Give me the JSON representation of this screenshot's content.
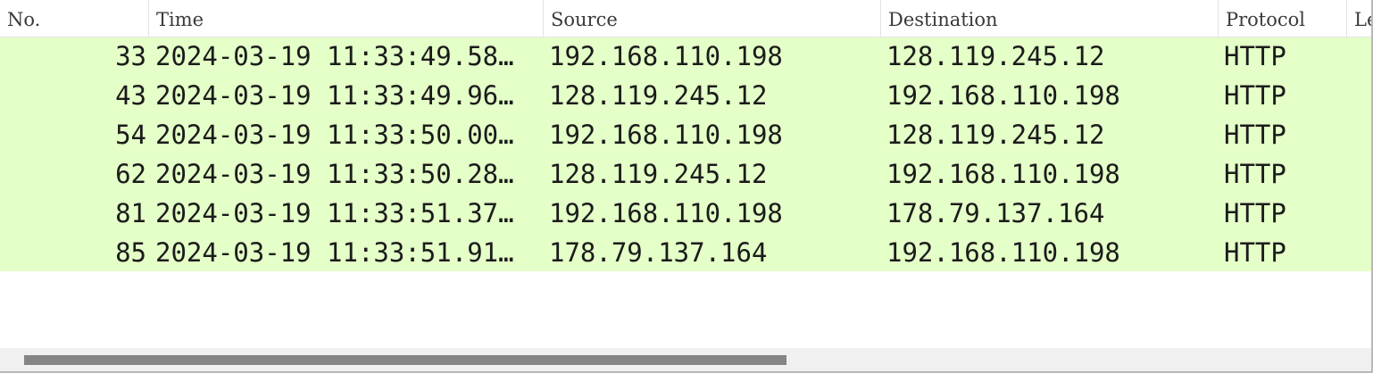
{
  "columns": {
    "no": "No.",
    "time": "Time",
    "source": "Source",
    "destination": "Destination",
    "protocol": "Protocol",
    "length": "Le"
  },
  "packets": [
    {
      "no": "33",
      "time": "2024-03-19 11:33:49.58…",
      "source": "192.168.110.198",
      "destination": "128.119.245.12",
      "protocol": "HTTP"
    },
    {
      "no": "43",
      "time": "2024-03-19 11:33:49.96…",
      "source": "128.119.245.12",
      "destination": "192.168.110.198",
      "protocol": "HTTP"
    },
    {
      "no": "54",
      "time": "2024-03-19 11:33:50.00…",
      "source": "192.168.110.198",
      "destination": "128.119.245.12",
      "protocol": "HTTP"
    },
    {
      "no": "62",
      "time": "2024-03-19 11:33:50.28…",
      "source": "128.119.245.12",
      "destination": "192.168.110.198",
      "protocol": "HTTP"
    },
    {
      "no": "81",
      "time": "2024-03-19 11:33:51.37…",
      "source": "192.168.110.198",
      "destination": "178.79.137.164",
      "protocol": "HTTP"
    },
    {
      "no": "85",
      "time": "2024-03-19 11:33:51.91…",
      "source": "178.79.137.164",
      "destination": "192.168.110.198",
      "protocol": "HTTP"
    }
  ],
  "colors": {
    "row_highlight": "#e4ffc7",
    "scrollbar_thumb": "#858585"
  }
}
